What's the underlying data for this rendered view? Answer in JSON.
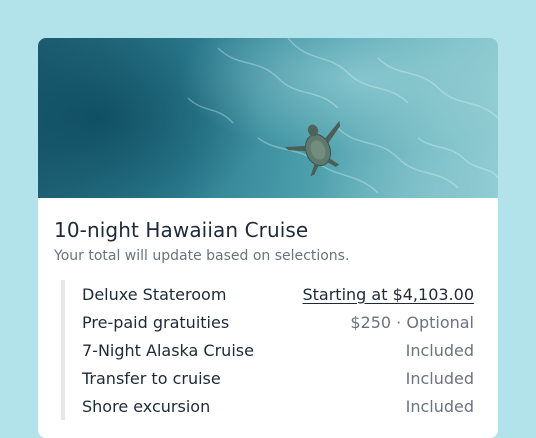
{
  "hero": {
    "icon": "sea-turtle-photo"
  },
  "cruise": {
    "title": "10-night Hawaiian Cruise",
    "subtitle": "Your total will update based on selections."
  },
  "items": [
    {
      "label": "Deluxe Stateroom",
      "value": "Starting at $4,103.00"
    },
    {
      "label": "Pre-paid gratuities",
      "value": "$250 · Optional"
    },
    {
      "label": "7-Night Alaska Cruise",
      "value": "Included"
    },
    {
      "label": "Transfer to cruise",
      "value": "Included"
    },
    {
      "label": "Shore excursion",
      "value": "Included"
    }
  ],
  "colors": {
    "page_background": "#b2e3ea",
    "card_background": "#ffffff",
    "text_primary": "#1f2937",
    "text_secondary": "#6b7280",
    "list_accent": "#e5e7eb"
  }
}
